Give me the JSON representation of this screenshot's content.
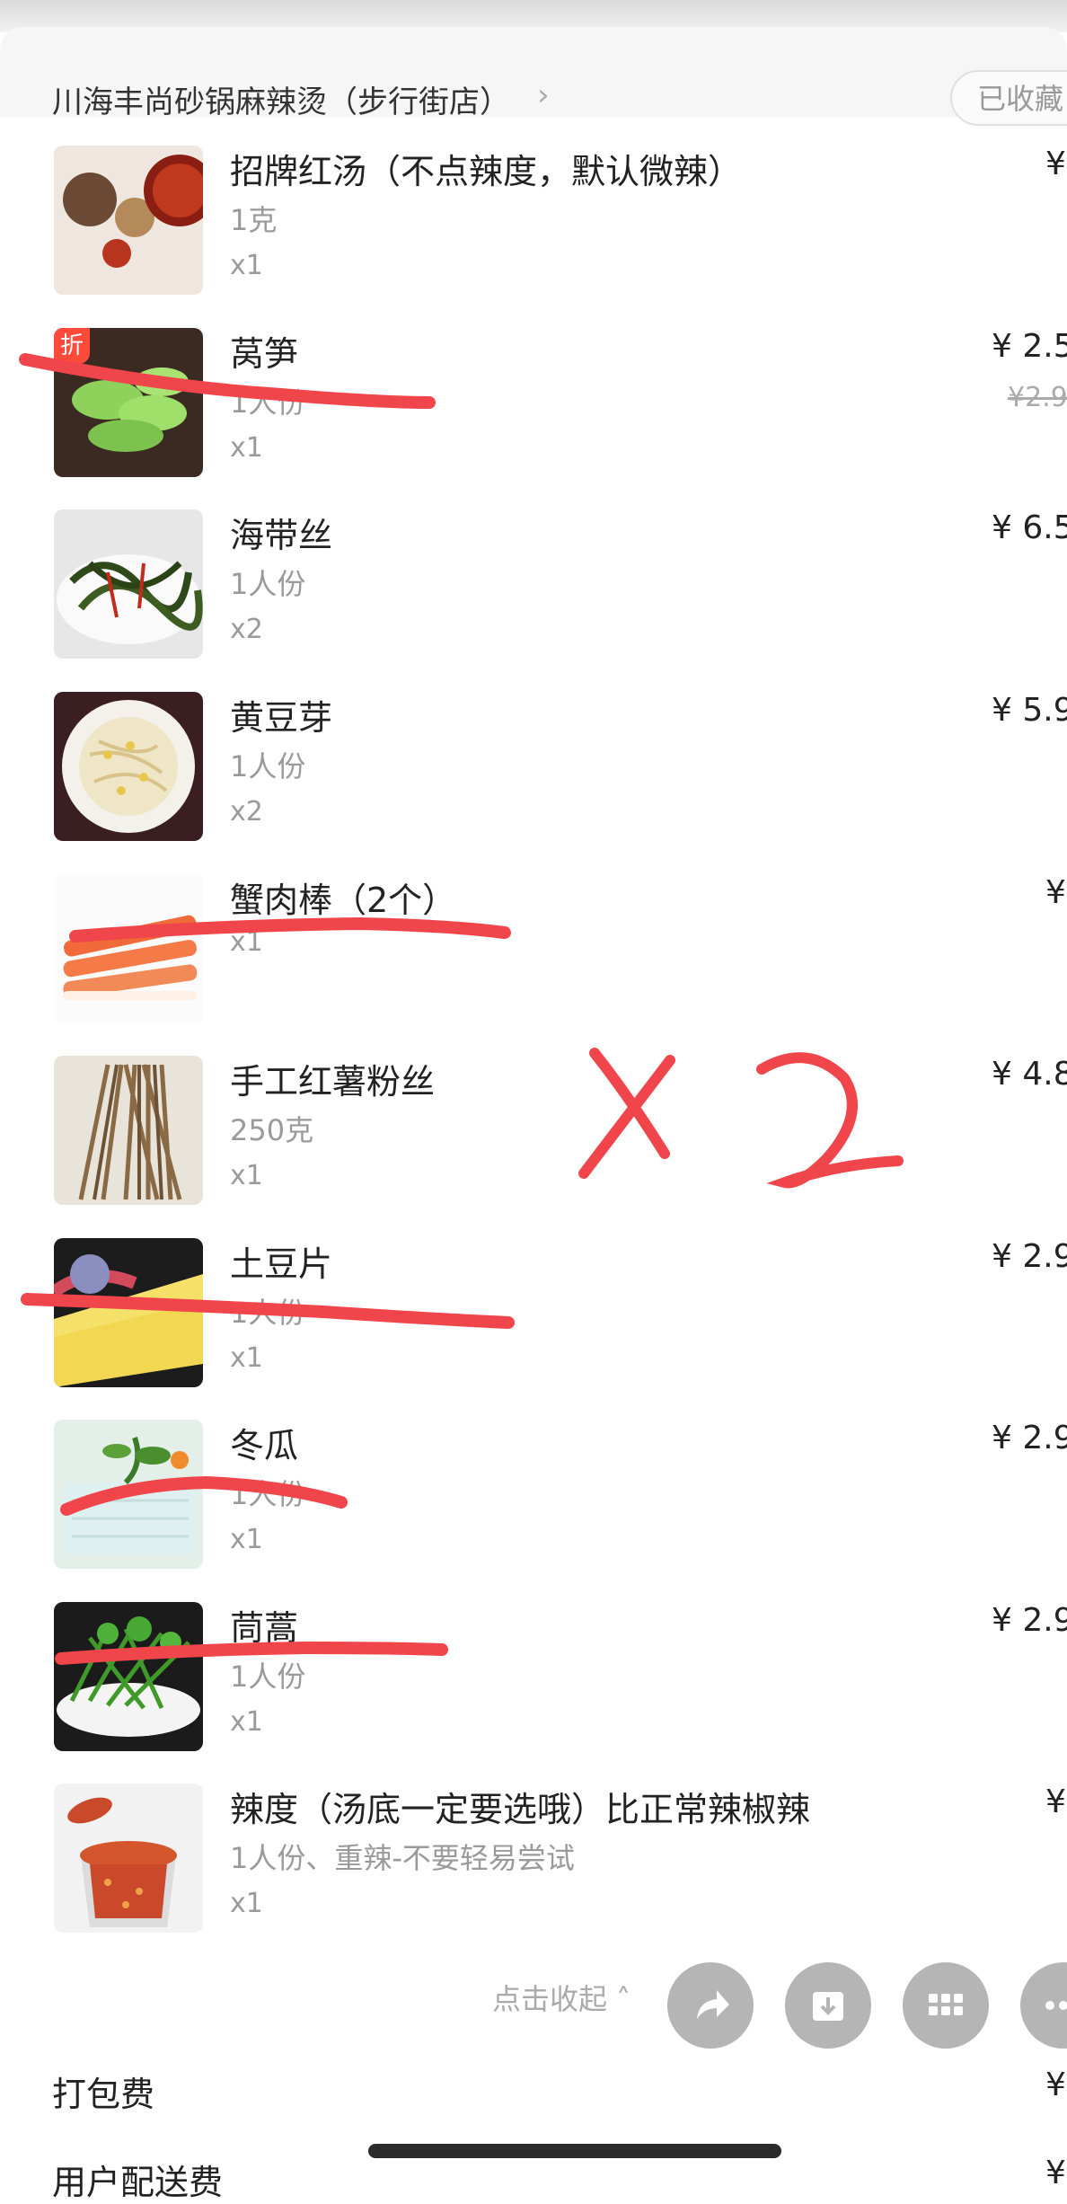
{
  "header": {
    "store_name": "川海丰尚砂锅麻辣烫（步行街店）",
    "chevron": "›",
    "favorite_label": "已收藏"
  },
  "items": [
    {
      "name": "招牌红汤（不点辣度，默认微辣）",
      "spec": "1克",
      "qty": "x1",
      "price": "¥"
    },
    {
      "name": "莴笋",
      "spec": "1人份",
      "qty": "x1",
      "price": "¥ 2.5",
      "original_price": "¥2.9",
      "tag": "折"
    },
    {
      "name": "海带丝",
      "spec": "1人份",
      "qty": "x2",
      "price": "¥ 6.5"
    },
    {
      "name": "黄豆芽",
      "spec": "1人份",
      "qty": "x2",
      "price": "¥ 5.9"
    },
    {
      "name": "蟹肉棒（2个）",
      "qty": "x1",
      "price": "¥"
    },
    {
      "name": "手工红薯粉丝",
      "spec": "250克",
      "qty": "x1",
      "price": "¥ 4.8"
    },
    {
      "name": "土豆片",
      "spec": "1人份",
      "qty": "x1",
      "price": "¥ 2.9"
    },
    {
      "name": "冬瓜",
      "spec": "1人份",
      "qty": "x1",
      "price": "¥ 2.9"
    },
    {
      "name": "茼蒿",
      "spec": "1人份",
      "qty": "x1",
      "price": "¥ 2.9"
    },
    {
      "name": "辣度（汤底一定要选哦）比正常辣椒辣",
      "spec": "1人份、重辣-不要轻易尝试",
      "qty": "x1",
      "price": "¥"
    }
  ],
  "collapse_label": "点击收起 ˄",
  "fees": {
    "packing_label": "打包费",
    "packing_price": "¥",
    "delivery_label": "用户配送费",
    "delivery_price": "¥"
  },
  "annotation": {
    "handwritten_note": "x 2",
    "color": "#f0454a"
  },
  "fab_icons": [
    "share-icon",
    "download-icon",
    "grid-icon",
    "more-icon"
  ]
}
